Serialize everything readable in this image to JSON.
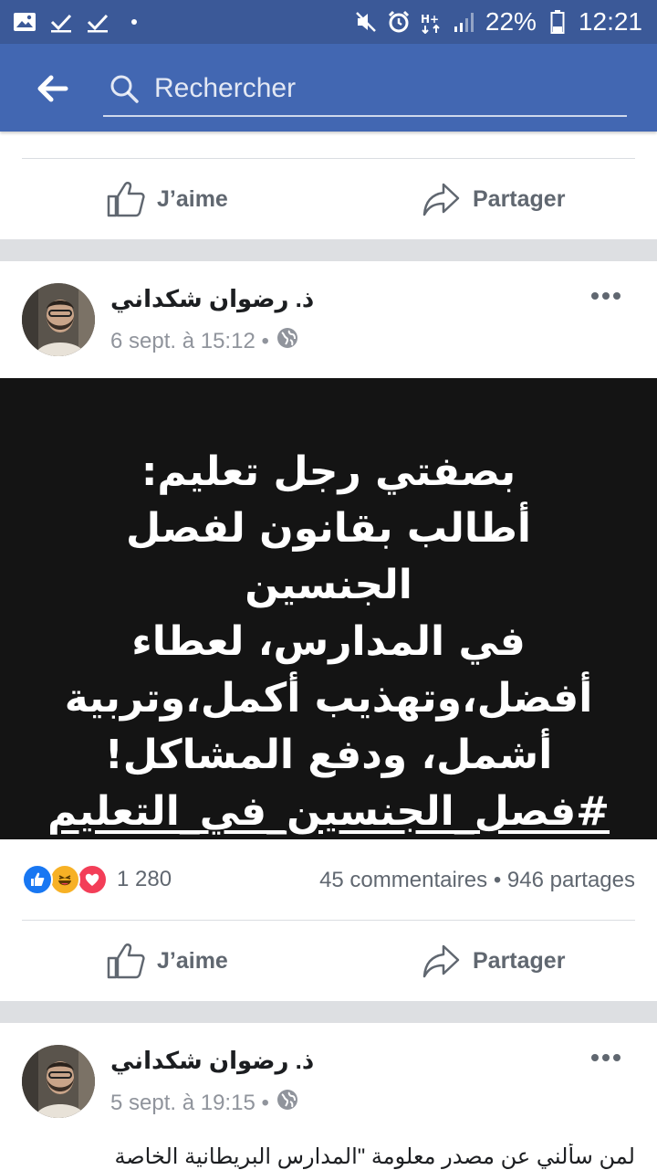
{
  "status_bar": {
    "battery": "22%",
    "time": "12:21",
    "left_icons": [
      "gallery-icon",
      "check-icon",
      "check-icon",
      "dot-icon"
    ],
    "right_icons": [
      "mute-icon",
      "alarm-icon",
      "network-h-plus-icon",
      "signal-icon",
      "battery-icon"
    ]
  },
  "app_bar": {
    "search_placeholder": "Rechercher"
  },
  "actions": {
    "like_label": "J’aime",
    "share_label": "Partager"
  },
  "posts": [
    {
      "author": "ذ. رضوان شكداني",
      "timestamp": "6 sept. à 15:12 •",
      "image_text_lines": [
        "بصفتي رجل تعليم:",
        "أطالب بقانون لفصل الجنسين",
        "في المدارس، لعطاء",
        "أفضل،وتهذيب أكمل،وتربية",
        "أشمل، ودفع المشاكل!"
      ],
      "image_hashtag": "#فصل_الجنسين_في_التعليم",
      "reactions_count": "1 280",
      "comments": "45 commentaires",
      "shares": "946 partages",
      "reaction_icons": [
        "like-reaction-icon",
        "haha-reaction-icon",
        "love-reaction-icon"
      ]
    },
    {
      "author": "ذ. رضوان شكداني",
      "timestamp": "5 sept. à 19:15 •",
      "body_preview": "لمن سألني عن مصدر معلومة \"المدارس البريطانية الخاصة"
    }
  ],
  "colors": {
    "status_bar": "#3b5998",
    "app_bar": "#4267b2",
    "separator": "#dddfe2",
    "secondary_text": "#606770",
    "like_blue": "#1877f2",
    "love_red": "#f33e58",
    "haha_yellow": "#f7b125"
  }
}
